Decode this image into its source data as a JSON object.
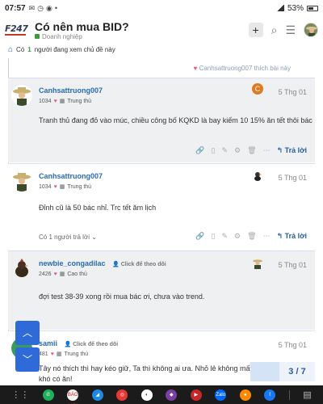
{
  "status_bar": {
    "time": "07:57",
    "battery": "53%"
  },
  "header": {
    "logo": "F247",
    "title": "Có nên mua BID?",
    "category": "Doanh nghiệp",
    "plus": "+"
  },
  "viewers": {
    "prefix": "Có",
    "count": "1",
    "suffix": "người đang xem chủ đề này"
  },
  "liked_by": {
    "name": "Canhsattruong007",
    "text": "thích bài này"
  },
  "posts": [
    {
      "username": "Canhsattruong007",
      "points": "1034",
      "rank": "Trung thủ",
      "date": "5 Thg 01",
      "body": "Tranh thủ đang đỏ vào múc, chiều công bố KQKD là bay kiếm 10 15% ăn tết thôi bác",
      "reply_avatar": "C",
      "reply_label": "Trả lời"
    },
    {
      "username": "Canhsattruong007",
      "points": "1034",
      "rank": "Trung thủ",
      "date": "5 Thg 01",
      "body": "Đỉnh cũ là 50 bác nhỉ. Trc tết ăm lịch",
      "reply_count": "Có 1 người trả lời",
      "reply_label": "Trả lời"
    },
    {
      "username": "newbie_congadilac",
      "follow": "Click để theo dõi",
      "points": "2426",
      "rank": "Cao thủ",
      "date": "5 Thg 01",
      "body": "đợi test 38-39 xong rồi mua bác ơi, chưa vào trend."
    },
    {
      "username": "samii",
      "follow": "Click để theo dõi",
      "points": "481",
      "rank": "Trung thủ",
      "date": "5 Thg 01",
      "body_line1": "Tây nó thích thì hay kéo giữ, Ta thì không ai ưa. Nhỏ lẻ không mấy khi",
      "body_line2": "khó có ăn!"
    }
  ],
  "pagination": {
    "label": "3 / 7"
  },
  "navbar": {
    "apps": [
      "",
      "",
      "BÁO MỚI",
      "",
      "",
      "",
      "",
      "",
      "Zalo",
      "",
      "",
      ""
    ]
  },
  "colors": {
    "accent": "#2a5d9f",
    "username": "#2a6bb0",
    "post_bg": "#eef0f2",
    "fab": "#2f6bd8"
  }
}
